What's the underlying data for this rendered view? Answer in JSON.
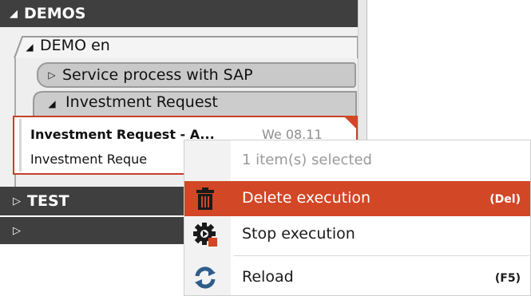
{
  "tree": {
    "demos_label": "DEMOS",
    "demo_en_label": "DEMO en",
    "service_label": "Service process with SAP",
    "investment_label": "Investment Request",
    "executions": [
      {
        "name": "Investment Request - A...",
        "date": "We 08.11"
      },
      {
        "name": "Investment Reque",
        "date": ""
      }
    ],
    "test_label": "TEST",
    "unnamed_label": ""
  },
  "context_menu": {
    "selected_info": "1 item(s) selected",
    "items": [
      {
        "label": "Delete execution",
        "shortcut": "(Del)",
        "icon": "trash-icon",
        "highlighted": true
      },
      {
        "label": "Stop execution",
        "shortcut": "",
        "icon": "stop-execution-gear-icon"
      },
      {
        "label": "Reload",
        "shortcut": "(F5)",
        "icon": "reload-icon"
      }
    ]
  },
  "colors": {
    "header_dark": "#3f3f3f",
    "accent": "#d24726"
  }
}
